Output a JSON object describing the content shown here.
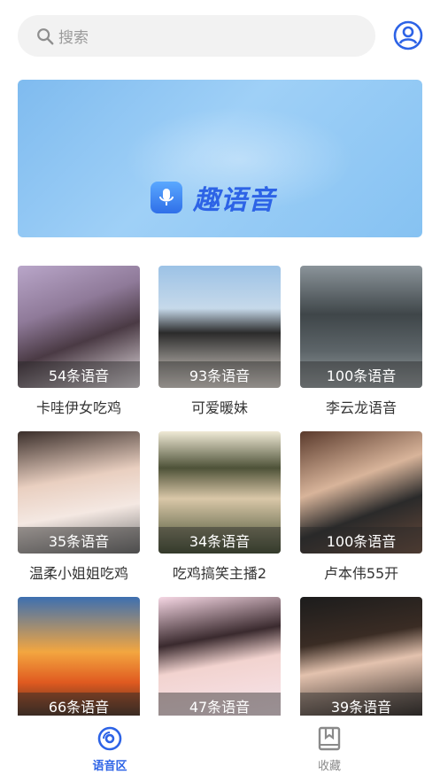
{
  "search": {
    "placeholder": "搜索"
  },
  "banner": {
    "brand": "趣语音"
  },
  "cards": [
    {
      "count": "54条语音",
      "name": "卡哇伊女吃鸡"
    },
    {
      "count": "93条语音",
      "name": "可爱暖妹"
    },
    {
      "count": "100条语音",
      "name": "李云龙语音"
    },
    {
      "count": "35条语音",
      "name": "温柔小姐姐吃鸡"
    },
    {
      "count": "34条语音",
      "name": "吃鸡搞笑主播2"
    },
    {
      "count": "100条语音",
      "name": "卢本伟55开"
    },
    {
      "count": "66条语音",
      "name": ""
    },
    {
      "count": "47条语音",
      "name": ""
    },
    {
      "count": "39条语音",
      "name": ""
    }
  ],
  "tabs": [
    {
      "label": "语音区",
      "icon": "voice-disc-icon",
      "active": true
    },
    {
      "label": "收藏",
      "icon": "bookmark-icon",
      "active": false
    }
  ],
  "colors": {
    "accent": "#2d63e6",
    "search_bg": "#f2f2f2"
  }
}
